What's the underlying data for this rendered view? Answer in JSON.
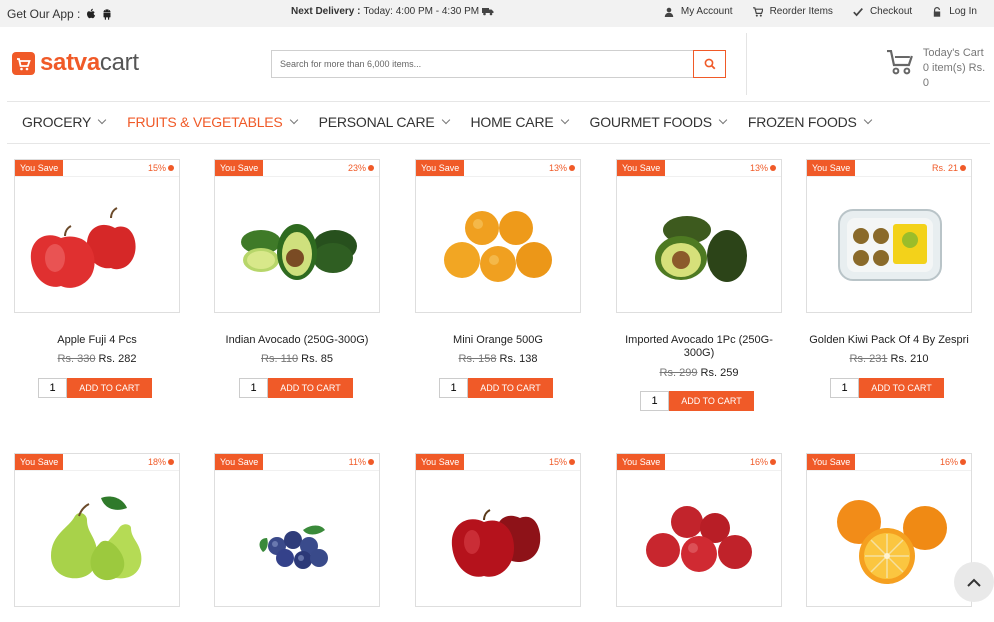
{
  "topbar": {
    "app_label": "Get Our App :",
    "delivery_label": "Next Delivery :",
    "delivery_value": "Today: 4:00 PM - 4:30 PM",
    "links": [
      "My Account",
      "Reorder Items",
      "Checkout",
      "Log In"
    ]
  },
  "brand": {
    "part1": "satva",
    "part2": "cart",
    "accent": "#f05a28"
  },
  "search": {
    "placeholder": "Search for more than 6,000 items..."
  },
  "cart": {
    "title": "Today's Cart",
    "summary": "0 item(s) Rs. 0"
  },
  "nav": [
    "GROCERY",
    "FRUITS & VEGETABLES",
    "PERSONAL CARE",
    "HOME CARE",
    "GOURMET FOODS",
    "FROZEN FOODS"
  ],
  "nav_active_index": 1,
  "products": [
    {
      "badge": "You Save",
      "save": "15%",
      "name": "Apple Fuji 4 Pcs",
      "old_price": "Rs. 330",
      "price": "Rs. 282",
      "qty": "1",
      "add_label": "ADD TO CART",
      "image": "red-apples"
    },
    {
      "badge": "You Save",
      "save": "23%",
      "name": "Indian Avocado (250G-300G)",
      "old_price": "Rs. 110",
      "price": "Rs. 85",
      "qty": "1",
      "add_label": "ADD TO CART",
      "image": "avocados"
    },
    {
      "badge": "You Save",
      "save": "13%",
      "name": "Mini Orange 500G",
      "old_price": "Rs. 158",
      "price": "Rs. 138",
      "qty": "1",
      "add_label": "ADD TO CART",
      "image": "mini-oranges"
    },
    {
      "badge": "You Save",
      "save": "13%",
      "name": "Imported Avocado 1Pc (250G-300G)",
      "old_price": "Rs. 299",
      "price": "Rs. 259",
      "qty": "1",
      "add_label": "ADD TO CART",
      "image": "imported-avocados"
    },
    {
      "badge": "You Save",
      "save": "Rs. 21",
      "name": "Golden Kiwi Pack Of 4 By Zespri",
      "old_price": "Rs. 231",
      "price": "Rs. 210",
      "qty": "1",
      "add_label": "ADD TO CART",
      "image": "kiwi-pack"
    },
    {
      "badge": "You Save",
      "save": "18%",
      "image": "pears"
    },
    {
      "badge": "You Save",
      "save": "11%",
      "image": "blueberries"
    },
    {
      "badge": "You Save",
      "save": "15%",
      "image": "dark-red-apples"
    },
    {
      "badge": "You Save",
      "save": "16%",
      "image": "apple-pile"
    },
    {
      "badge": "You Save",
      "save": "16%",
      "image": "oranges"
    }
  ]
}
